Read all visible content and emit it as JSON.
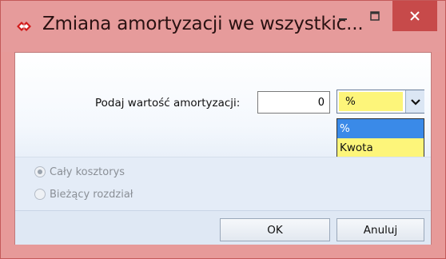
{
  "window": {
    "title": "Zmiana amortyzacji we wszystkic...",
    "accent_color": "#e69b9b",
    "close_color": "#c74a4a"
  },
  "icons": {
    "app": "double-diamond-icon",
    "minimize": "minimize-icon",
    "maximize": "maximize-icon",
    "close": "close-icon",
    "dropdown": "chevron-down-icon"
  },
  "form": {
    "label": "Podaj wartość amortyzacji:",
    "value": "0",
    "unit_selected": "%",
    "unit_options": [
      "%",
      "Kwota"
    ],
    "highlight_color": "#fdf57a",
    "selection_color": "#3a8ae8"
  },
  "scope": {
    "options": [
      {
        "label": "Cały kosztorys",
        "checked": true
      },
      {
        "label": "Bieżący rozdział",
        "checked": false
      }
    ]
  },
  "buttons": {
    "ok": "OK",
    "cancel": "Anuluj"
  }
}
